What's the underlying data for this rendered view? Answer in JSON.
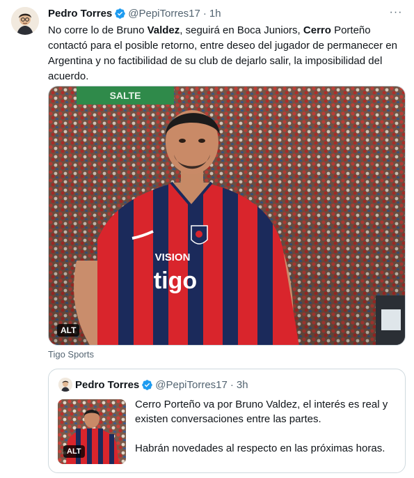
{
  "tweet": {
    "author_name": "Pedro Torres",
    "handle": "@PepiTorres17",
    "separator": "·",
    "time": "1h",
    "more_label": "···",
    "text_parts": [
      "No corre lo de Bruno ",
      "Valdez",
      ", seguirá en Boca Juniors, ",
      "Cerro",
      " Porteño contactó para el posible retorno, entre deseo del jugador de permanecer en Argentina y no factibilidad de su club de dejarlo salir, la imposibilidad del acuerdo."
    ],
    "media": {
      "alt_label": "ALT",
      "jersey_brand": "VISION",
      "jersey_sponsor": "tigo",
      "banner_text": "SALTE"
    },
    "media_source": "Tigo Sports"
  },
  "quoted": {
    "author_name": "Pedro Torres",
    "handle": "@PepiTorres17",
    "separator": "·",
    "time": "3h",
    "alt_label": "ALT",
    "paragraphs": [
      "Cerro Porteño va por Bruno Valdez, el interés es real y existen conversaciones entre las partes.",
      "Habrán novedades al respecto en las próximas horas."
    ]
  },
  "colors": {
    "text_primary": "#0f1419",
    "text_secondary": "#536471",
    "verified_blue": "#1d9bf0",
    "border": "#cfd9de",
    "jersey_red": "#d9252c",
    "jersey_navy": "#1b2a5b"
  },
  "icons": {
    "verified": "verified-badge-icon",
    "more": "more-options-icon"
  }
}
